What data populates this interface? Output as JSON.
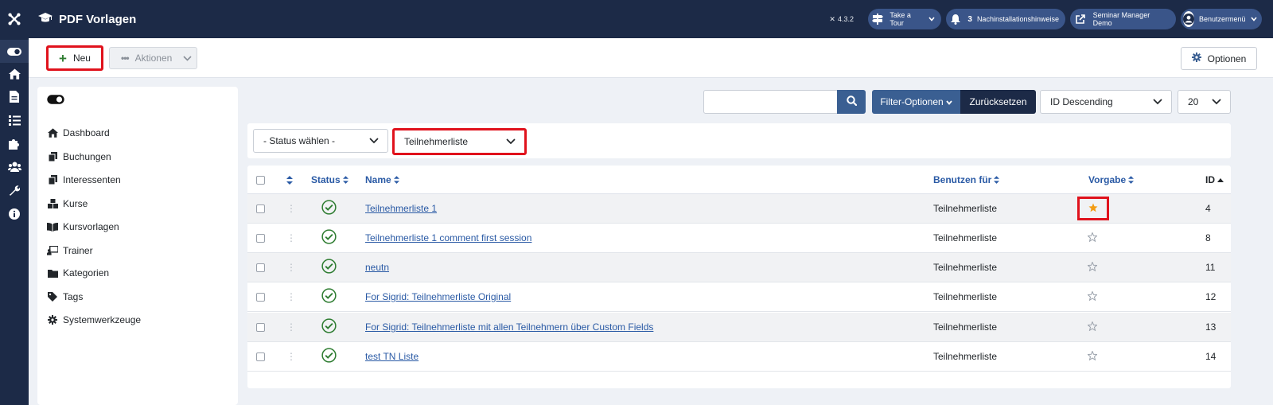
{
  "app": {
    "title": "PDF Vorlagen",
    "version": "4.3.2"
  },
  "header": {
    "tour_label": "Take a Tour",
    "notif_count": "3",
    "notif_label": "Nachinstallationshinweise",
    "site_label": "Seminar Manager Demo",
    "user_label": "Benutzermenü"
  },
  "toolbar": {
    "new_label": "Neu",
    "actions_label": "Aktionen",
    "options_label": "Optionen"
  },
  "sidebar": {
    "items": [
      {
        "label": "Dashboard",
        "icon": "home-icon"
      },
      {
        "label": "Buchungen",
        "icon": "copy-icon"
      },
      {
        "label": "Interessenten",
        "icon": "copy-icon"
      },
      {
        "label": "Kurse",
        "icon": "boxes-icon"
      },
      {
        "label": "Kursvorlagen",
        "icon": "book-icon"
      },
      {
        "label": "Trainer",
        "icon": "chalkboard-teacher-icon"
      },
      {
        "label": "Kategorien",
        "icon": "folder-icon"
      },
      {
        "label": "Tags",
        "icon": "tag-icon"
      },
      {
        "label": "Systemwerkzeuge",
        "icon": "gear-icon"
      }
    ]
  },
  "search": {
    "value": ""
  },
  "filters": {
    "filter_options_label": "Filter-Optionen",
    "reset_label": "Zurücksetzen",
    "order_value": "ID Descending",
    "limit_value": "20",
    "status_value": "- Status wählen -",
    "type_value": "Teilnehmerliste"
  },
  "table": {
    "headers": {
      "status": "Status",
      "name": "Name",
      "use_for": "Benutzen für",
      "default": "Vorgabe",
      "id": "ID"
    },
    "rows": [
      {
        "name": "Teilnehmerliste 1",
        "use_for": "Teilnehmerliste",
        "default": true,
        "id": "4"
      },
      {
        "name": "Teilnehmerliste 1 comment first session",
        "use_for": "Teilnehmerliste",
        "default": false,
        "id": "8"
      },
      {
        "name": "neutn",
        "use_for": "Teilnehmerliste",
        "default": false,
        "id": "11"
      },
      {
        "name": "For Sigrid: Teilnehmerliste Original",
        "use_for": "Teilnehmerliste",
        "default": false,
        "id": "12"
      },
      {
        "name": "For Sigrid: Teilnehmerliste mit allen Teilnehmern über Custom Fields",
        "use_for": "Teilnehmerliste",
        "default": false,
        "id": "13"
      },
      {
        "name": "test TN Liste",
        "use_for": "Teilnehmerliste",
        "default": false,
        "id": "14"
      }
    ]
  },
  "colors": {
    "primary": "#1c2a47",
    "accent": "#3a5f92",
    "link": "#2a5aa5",
    "success": "#2f7d32",
    "star": "#f39c12",
    "highlight": "#e0121c"
  }
}
